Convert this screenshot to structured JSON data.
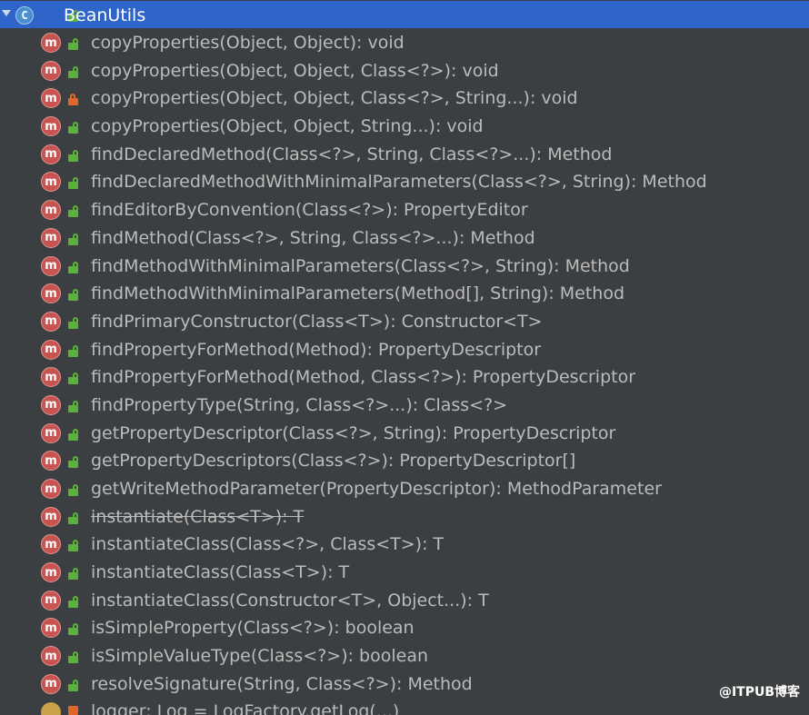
{
  "header": {
    "class_icon": "C",
    "title": "BeanUtils"
  },
  "method_icon_letter": "m",
  "methods": [
    {
      "signature": "copyProperties(Object, Object): void",
      "visibility": "public",
      "deprecated": false
    },
    {
      "signature": "copyProperties(Object, Object, Class<?>): void",
      "visibility": "public",
      "deprecated": false
    },
    {
      "signature": "copyProperties(Object, Object, Class<?>, String...): void",
      "visibility": "private",
      "deprecated": false
    },
    {
      "signature": "copyProperties(Object, Object, String...): void",
      "visibility": "public",
      "deprecated": false
    },
    {
      "signature": "findDeclaredMethod(Class<?>, String, Class<?>...): Method",
      "visibility": "public",
      "deprecated": false
    },
    {
      "signature": "findDeclaredMethodWithMinimalParameters(Class<?>, String): Method",
      "visibility": "public",
      "deprecated": false
    },
    {
      "signature": "findEditorByConvention(Class<?>): PropertyEditor",
      "visibility": "public",
      "deprecated": false
    },
    {
      "signature": "findMethod(Class<?>, String, Class<?>...): Method",
      "visibility": "public",
      "deprecated": false
    },
    {
      "signature": "findMethodWithMinimalParameters(Class<?>, String): Method",
      "visibility": "public",
      "deprecated": false
    },
    {
      "signature": "findMethodWithMinimalParameters(Method[], String): Method",
      "visibility": "public",
      "deprecated": false
    },
    {
      "signature": "findPrimaryConstructor(Class<T>): Constructor<T>",
      "visibility": "public",
      "deprecated": false
    },
    {
      "signature": "findPropertyForMethod(Method): PropertyDescriptor",
      "visibility": "public",
      "deprecated": false
    },
    {
      "signature": "findPropertyForMethod(Method, Class<?>): PropertyDescriptor",
      "visibility": "public",
      "deprecated": false
    },
    {
      "signature": "findPropertyType(String, Class<?>...): Class<?>",
      "visibility": "public",
      "deprecated": false
    },
    {
      "signature": "getPropertyDescriptor(Class<?>, String): PropertyDescriptor",
      "visibility": "public",
      "deprecated": false
    },
    {
      "signature": "getPropertyDescriptors(Class<?>): PropertyDescriptor[]",
      "visibility": "public",
      "deprecated": false
    },
    {
      "signature": "getWriteMethodParameter(PropertyDescriptor): MethodParameter",
      "visibility": "public",
      "deprecated": false
    },
    {
      "signature": "instantiate(Class<T>): T",
      "visibility": "public",
      "deprecated": true
    },
    {
      "signature": "instantiateClass(Class<?>, Class<T>): T",
      "visibility": "public",
      "deprecated": false
    },
    {
      "signature": "instantiateClass(Class<T>): T",
      "visibility": "public",
      "deprecated": false
    },
    {
      "signature": "instantiateClass(Constructor<T>, Object...): T",
      "visibility": "public",
      "deprecated": false
    },
    {
      "signature": "isSimpleProperty(Class<?>): boolean",
      "visibility": "public",
      "deprecated": false
    },
    {
      "signature": "isSimpleValueType(Class<?>): boolean",
      "visibility": "public",
      "deprecated": false
    },
    {
      "signature": "resolveSignature(String, Class<?>): Method",
      "visibility": "public",
      "deprecated": false
    }
  ],
  "partial_row_text": "logger: Log = LogFactory.getLog(...)",
  "watermark": "@ITPUB博客",
  "colors": {
    "background": "#3c3f41",
    "selection": "#2f65ca",
    "method_icon": "#c75450",
    "public_lock": "#5bb13c",
    "private_lock": "#e0662a",
    "text": "#bbbbbb"
  }
}
